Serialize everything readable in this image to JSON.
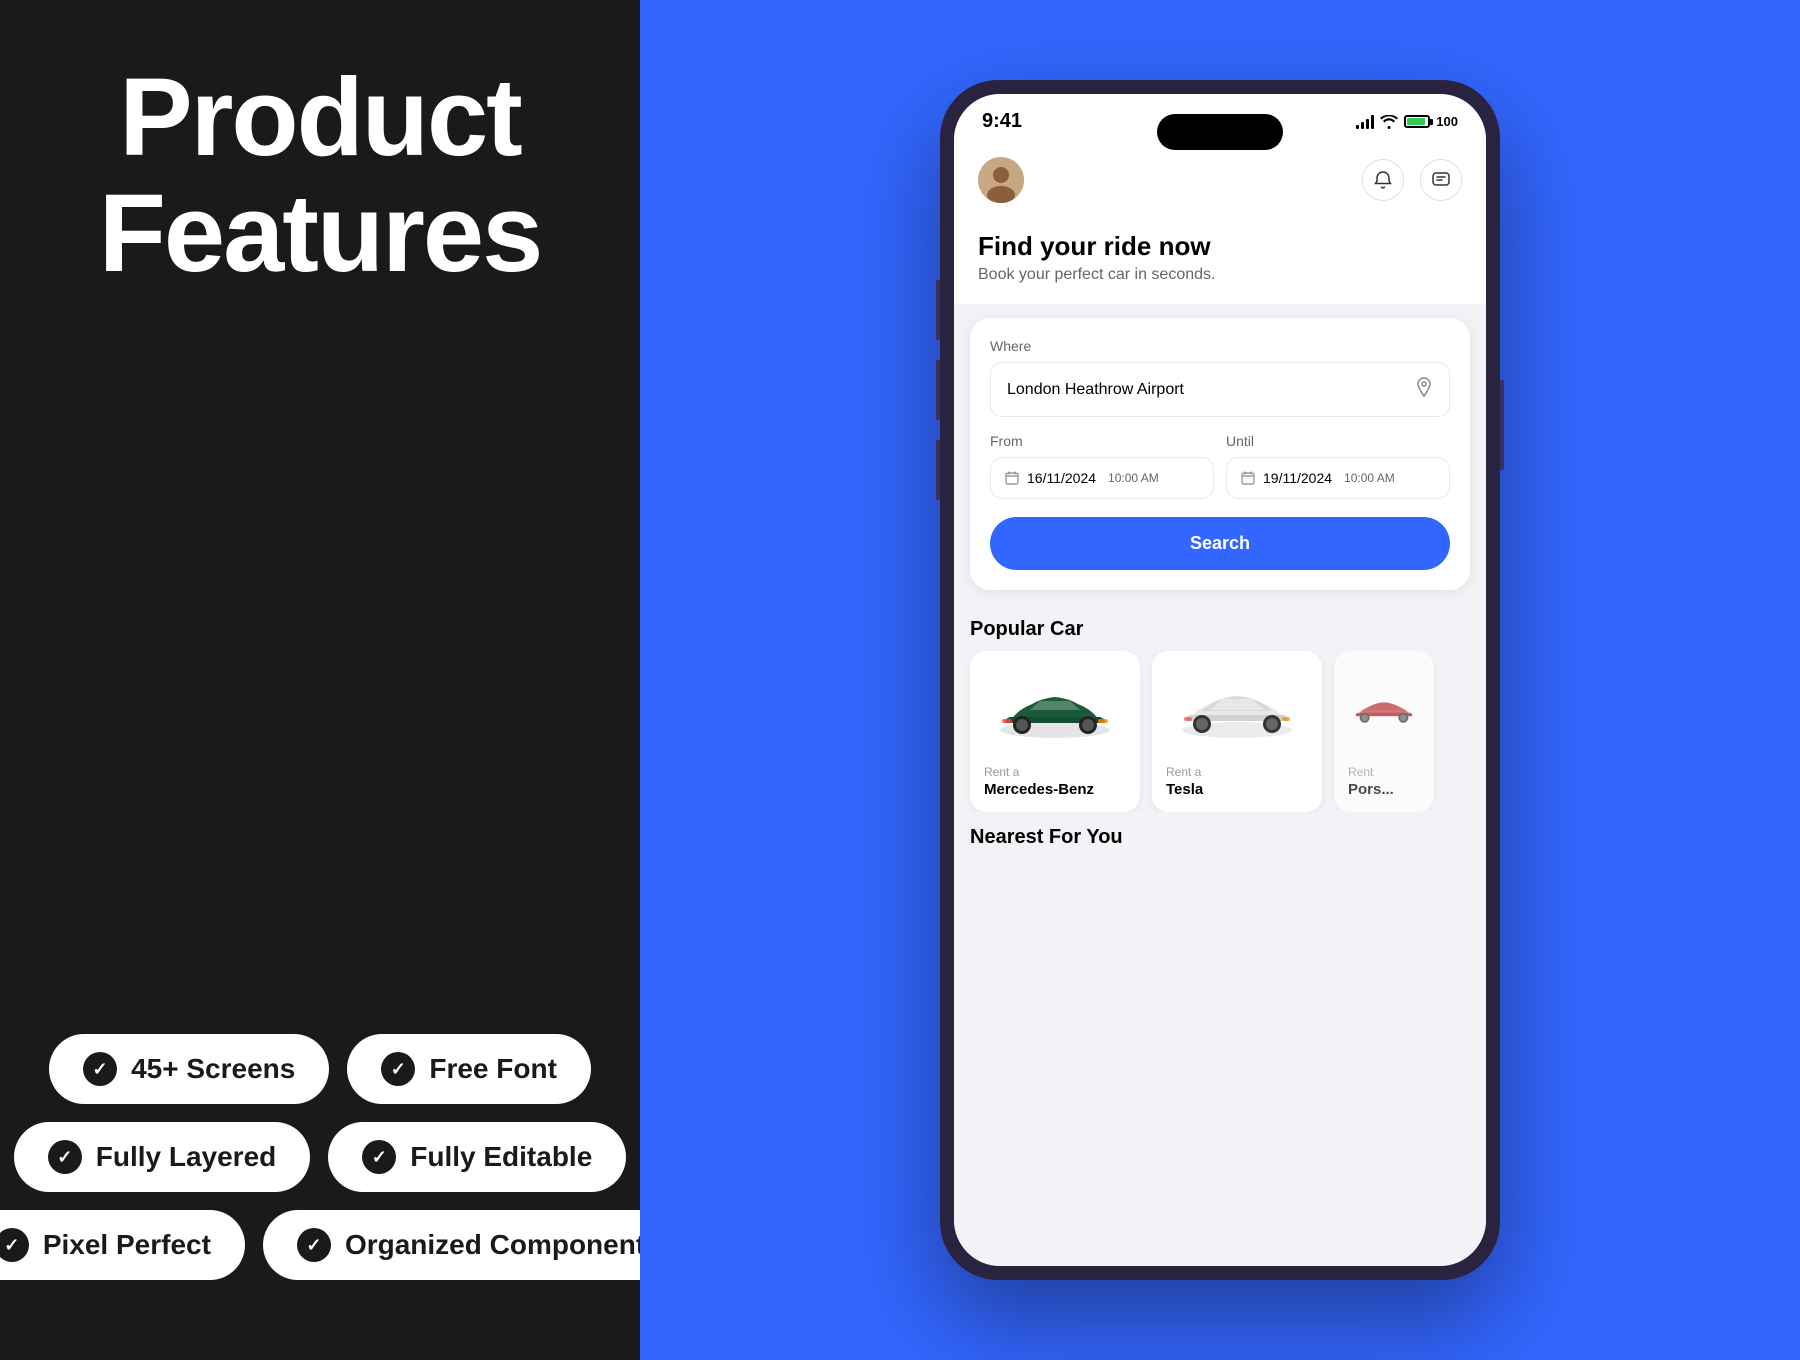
{
  "left": {
    "title_line1": "Product",
    "title_line2": "Features",
    "badges": [
      [
        {
          "id": "screens",
          "label": "45+ Screens"
        },
        {
          "id": "font",
          "label": "Free Font"
        }
      ],
      [
        {
          "id": "layered",
          "label": "Fully Layered"
        },
        {
          "id": "editable",
          "label": "Fully Editable"
        }
      ],
      [
        {
          "id": "pixel",
          "label": "Pixel Perfect"
        },
        {
          "id": "component",
          "label": "Organized Component"
        }
      ]
    ]
  },
  "phone": {
    "status_time": "9:41",
    "greeting_title": "Find your ride now",
    "greeting_subtitle": "Book your perfect car in seconds.",
    "where_label": "Where",
    "location_value": "London Heathrow Airport",
    "from_label": "From",
    "until_label": "Until",
    "from_date": "16/11/2024",
    "from_time": "10:00 AM",
    "until_date": "19/11/2024",
    "until_time": "10:00 AM",
    "search_button": "Search",
    "popular_cars_title": "Popular Car",
    "cars": [
      {
        "rent_label": "Rent a",
        "name": "Mercedes-Benz",
        "color": "#1a5c3a"
      },
      {
        "rent_label": "Rent a",
        "name": "Tesla",
        "color": "#e0e0e0"
      },
      {
        "rent_label": "Rent",
        "name": "Pors...",
        "color": "#cc3333"
      }
    ],
    "nearest_title": "Nearest For You"
  }
}
